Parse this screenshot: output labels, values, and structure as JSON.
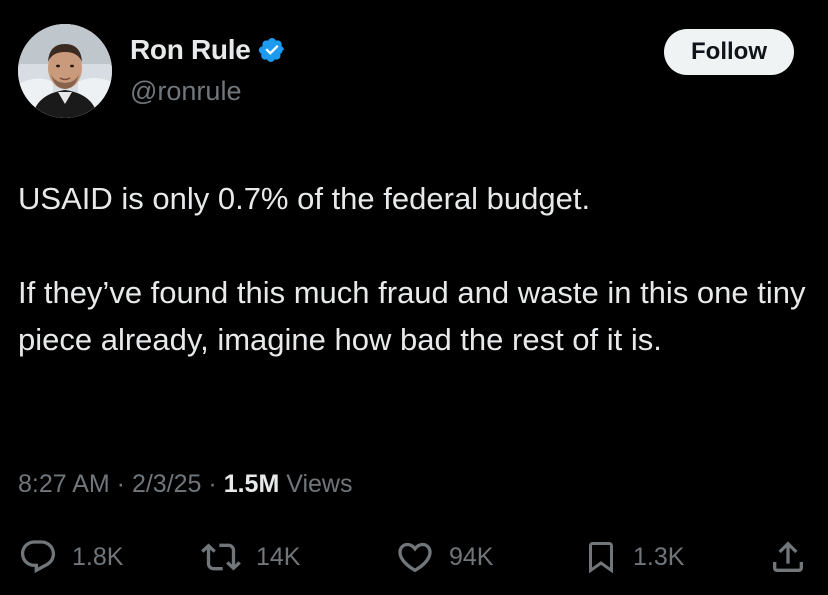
{
  "author": {
    "display_name": "Ron Rule",
    "handle": "@ronrule",
    "verified": true,
    "verified_color": "#1d9bf0",
    "avatar_icon": "profile-photo"
  },
  "follow_label": "Follow",
  "tweet": {
    "paragraphs": [
      "USAID is only 0.7% of the federal budget.",
      "If they’ve found this much fraud and waste in this one tiny piece already, imagine how bad the rest of it is."
    ]
  },
  "meta": {
    "time": "8:27 AM",
    "separator": " · ",
    "date": "2/3/25",
    "views_count": "1.5M",
    "views_label": " Views"
  },
  "actions": {
    "reply": {
      "icon": "reply-icon",
      "count": "1.8K"
    },
    "repost": {
      "icon": "repost-icon",
      "count": "14K"
    },
    "like": {
      "icon": "heart-icon",
      "count": "94K"
    },
    "bookmark": {
      "icon": "bookmark-icon",
      "count": "1.3K"
    },
    "share": {
      "icon": "share-icon"
    }
  },
  "colors": {
    "background": "#000000",
    "text_primary": "#e7e9ea",
    "text_secondary": "#71767b",
    "follow_bg": "#eff3f4"
  }
}
